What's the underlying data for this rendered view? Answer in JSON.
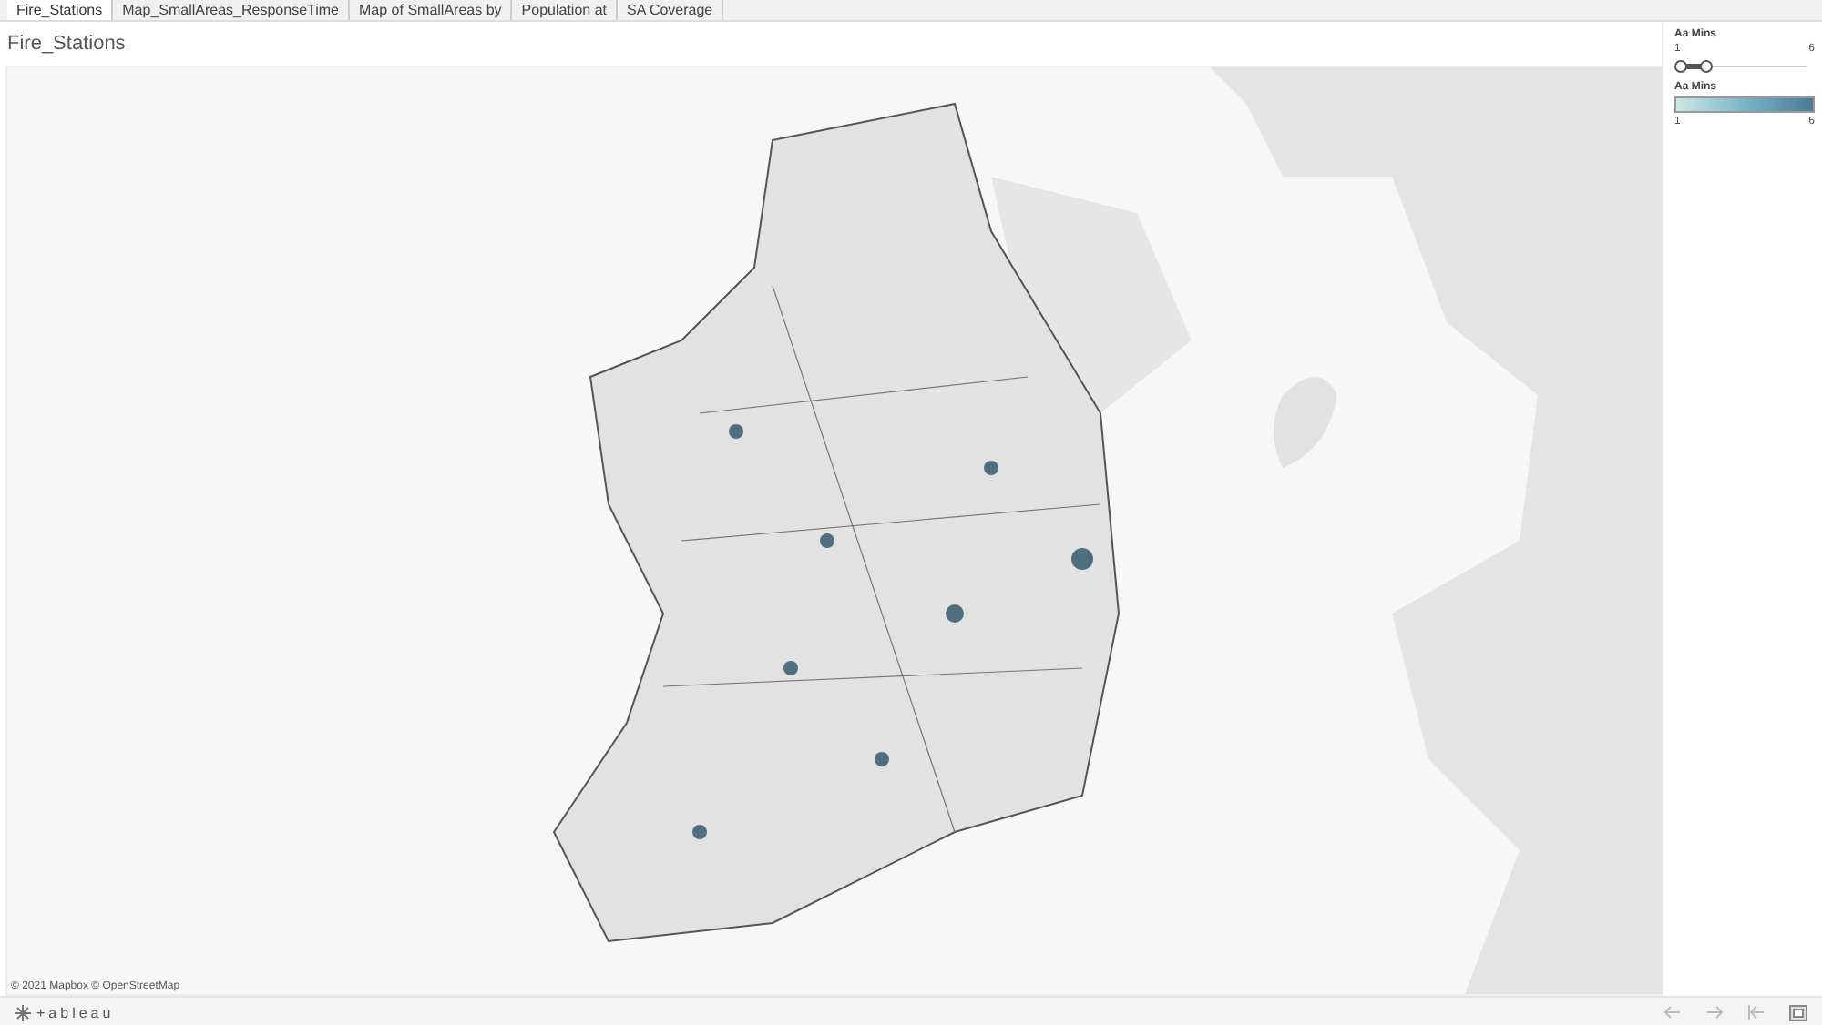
{
  "tabs": [
    {
      "label": "Fire_Stations",
      "selected": true
    },
    {
      "label": "Map_SmallAreas_ResponseTime",
      "selected": false
    },
    {
      "label": "Map of SmallAreas by",
      "selected": false
    },
    {
      "label": "Population at",
      "selected": false
    },
    {
      "label": "SA Coverage",
      "selected": false
    }
  ],
  "sheet": {
    "title": "Fire_Stations",
    "map": {
      "attribution": "© 2021 Mapbox  © OpenStreetMap"
    }
  },
  "filter": {
    "title": "Aa Mins",
    "min": "1",
    "max": "6",
    "level": 0.2
  },
  "legend": {
    "title": "Aa Mins",
    "min": "1",
    "max": "6"
  },
  "footer": {
    "logo": "+ableau"
  }
}
